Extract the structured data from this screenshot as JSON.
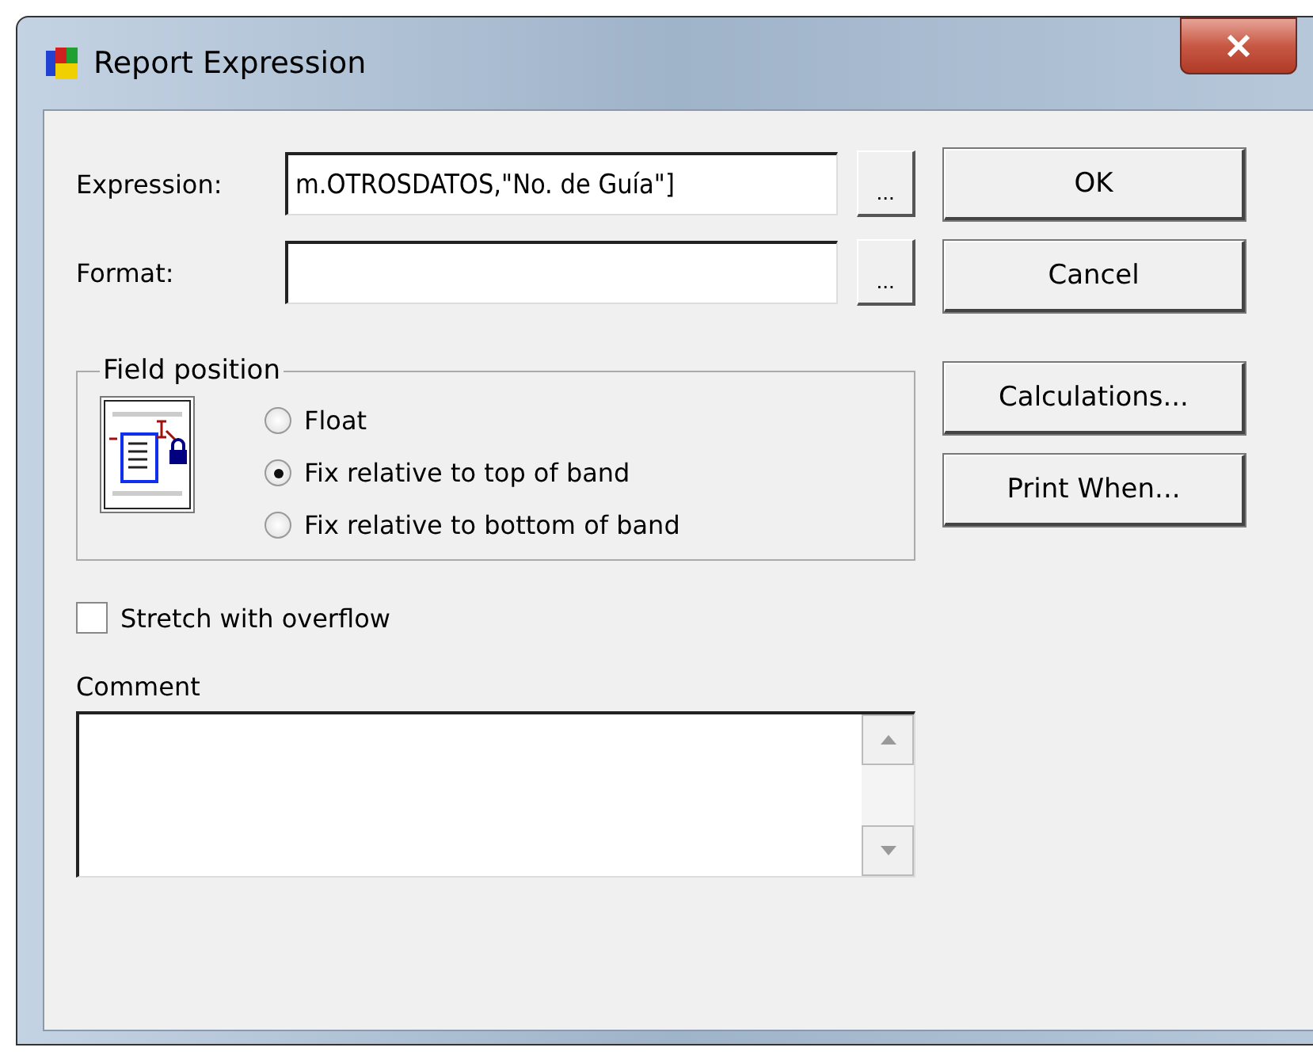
{
  "window": {
    "title": "Report Expression"
  },
  "fields": [
    {
      "label": "Expression:",
      "value": "m.OTROSDATOS,\"No. de Guía\"]",
      "browse": "..."
    },
    {
      "label": "Format:",
      "browse": "..."
    }
  ],
  "buttons": [
    {
      "label": "OK"
    },
    {
      "label": "Cancel"
    },
    {
      "label": "Calculations..."
    },
    {
      "label": "Print When..."
    }
  ],
  "field_position": {
    "title": "Field position",
    "options": [
      {
        "label": "Float",
        "selected": false
      },
      {
        "label": "Fix relative to top of band",
        "selected": true
      },
      {
        "label": "Fix relative to bottom of band",
        "selected": false
      }
    ]
  },
  "stretch": {
    "label": "Stretch with overflow",
    "checked": false
  },
  "comment": {
    "label": "Comment"
  }
}
